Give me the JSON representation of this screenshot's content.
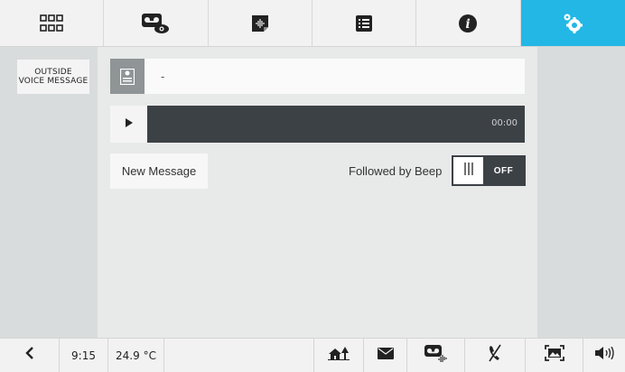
{
  "topbar": {
    "tabs": [
      {
        "icon": "grid-icon"
      },
      {
        "icon": "voicemail-view-icon"
      },
      {
        "icon": "audio-file-icon"
      },
      {
        "icon": "list-icon"
      },
      {
        "icon": "info-icon"
      },
      {
        "icon": "settings-icon",
        "active": true
      }
    ],
    "active_color": "#23b7e5"
  },
  "sidebar": {
    "item_line1": "OUTSIDE",
    "item_line2": "VOICE MESSAGE"
  },
  "message": {
    "name": "-"
  },
  "player": {
    "time": "00:00"
  },
  "actions": {
    "new_message_label": "New Message",
    "beep_label": "Followed by Beep",
    "toggle_state": "OFF"
  },
  "statusbar": {
    "time": "9:15",
    "temperature": "24.9 °C"
  }
}
